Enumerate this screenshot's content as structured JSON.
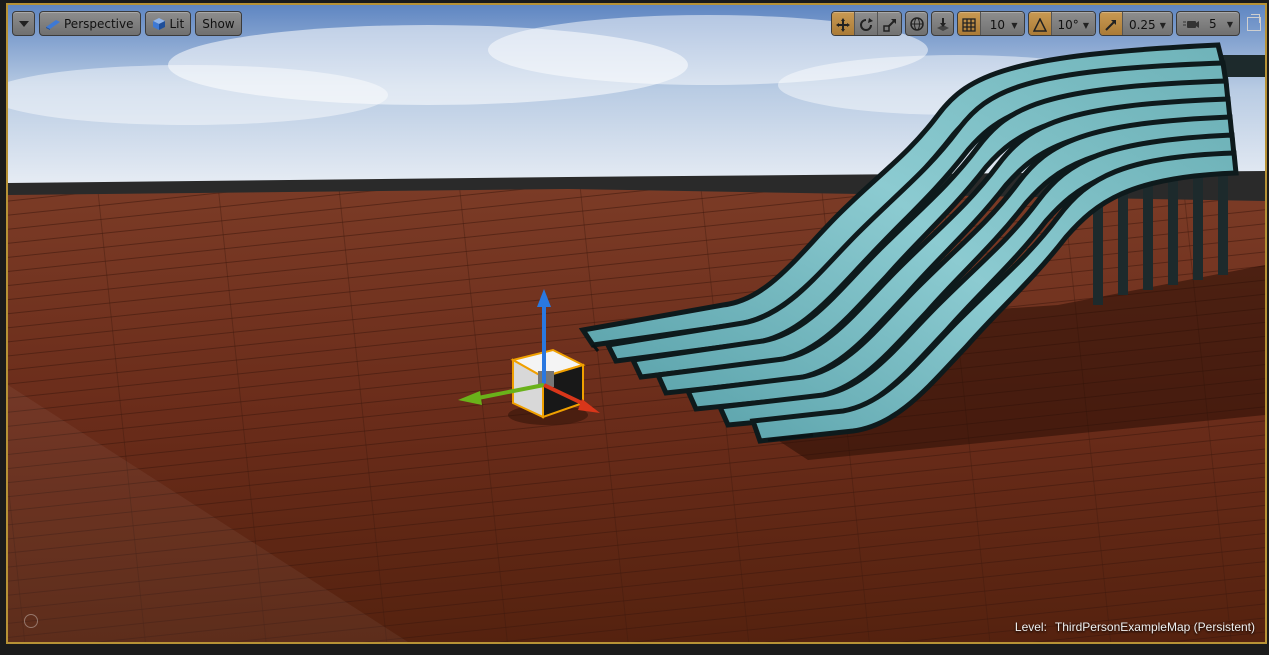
{
  "viewport": {
    "view_mode": "Perspective",
    "lighting_mode": "Lit",
    "show_label": "Show",
    "grid_snap_value": "10",
    "rotation_snap_value": "10°",
    "scale_snap_value": "0.25",
    "camera_speed_value": "5",
    "level_key": "Level:",
    "level_name": "ThirdPersonExampleMap (Persistent)"
  },
  "colors": {
    "frame_border": "#b79236",
    "active_button": "#c99a53",
    "floor_wood": "#6e2e1c",
    "sky": "#a9c2de",
    "wave_mesh": "#6fb3b9",
    "gizmo_x": "#d9361a",
    "gizmo_y": "#6ab21a",
    "gizmo_z": "#2a78e0"
  },
  "icons": [
    "chevron-down-icon",
    "perspective-icon",
    "lit-cube-icon",
    "translate-icon",
    "rotate-icon",
    "scale-icon",
    "world-icon",
    "surface-snap-icon",
    "grid-icon",
    "angle-icon",
    "scale-snap-icon",
    "camera-speed-icon",
    "maximize-icon"
  ]
}
